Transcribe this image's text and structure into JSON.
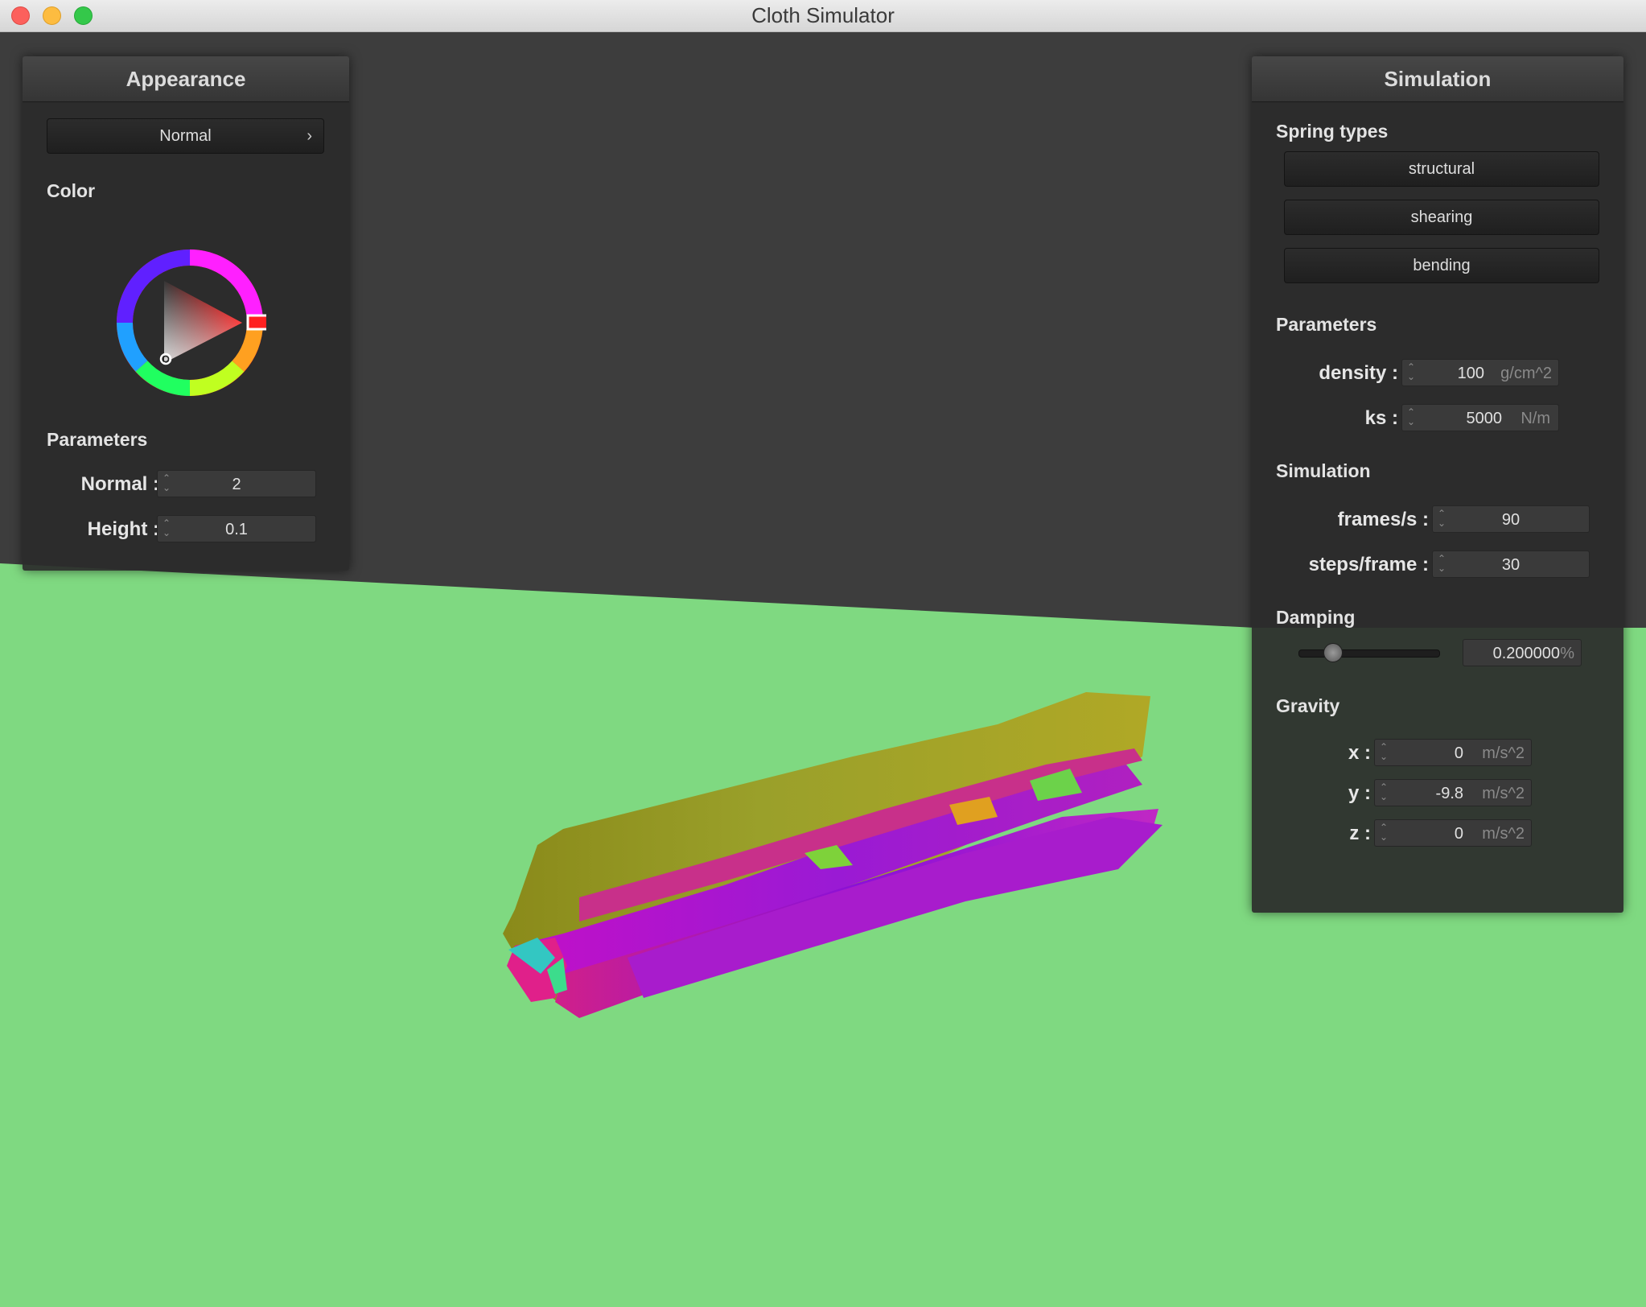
{
  "window": {
    "title": "Cloth Simulator"
  },
  "appearance": {
    "title": "Appearance",
    "shader": "Normal",
    "color_label": "Color",
    "params_label": "Parameters",
    "normal_label": "Normal :",
    "normal_value": "2",
    "height_label": "Height :",
    "height_value": "0.1"
  },
  "simulation": {
    "title": "Simulation",
    "spring_types_label": "Spring types",
    "springs": [
      "structural",
      "shearing",
      "bending"
    ],
    "params_label": "Parameters",
    "density_label": "density :",
    "density_value": "100",
    "density_unit": "g/cm^2",
    "ks_label": "ks :",
    "ks_value": "5000",
    "ks_unit": "N/m",
    "sim_label": "Simulation",
    "fps_label": "frames/s :",
    "fps_value": "90",
    "steps_label": "steps/frame :",
    "steps_value": "30",
    "damping_label": "Damping",
    "damping_value": "0.200000",
    "damping_unit": "%",
    "damping_slider_fraction": 0.2,
    "gravity_label": "Gravity",
    "gx_label": "x :",
    "gx_value": "0",
    "gy_label": "y :",
    "gy_value": "-9.8",
    "gz_label": "z :",
    "gz_value": "0",
    "gravity_unit": "m/s^2"
  },
  "colors": {
    "floor": "#7fd981",
    "background": "#3d3d3d",
    "selected_color": "#ff0000"
  },
  "icons": [
    "chevron-right-icon",
    "spinner-icon",
    "color-wheel"
  ]
}
